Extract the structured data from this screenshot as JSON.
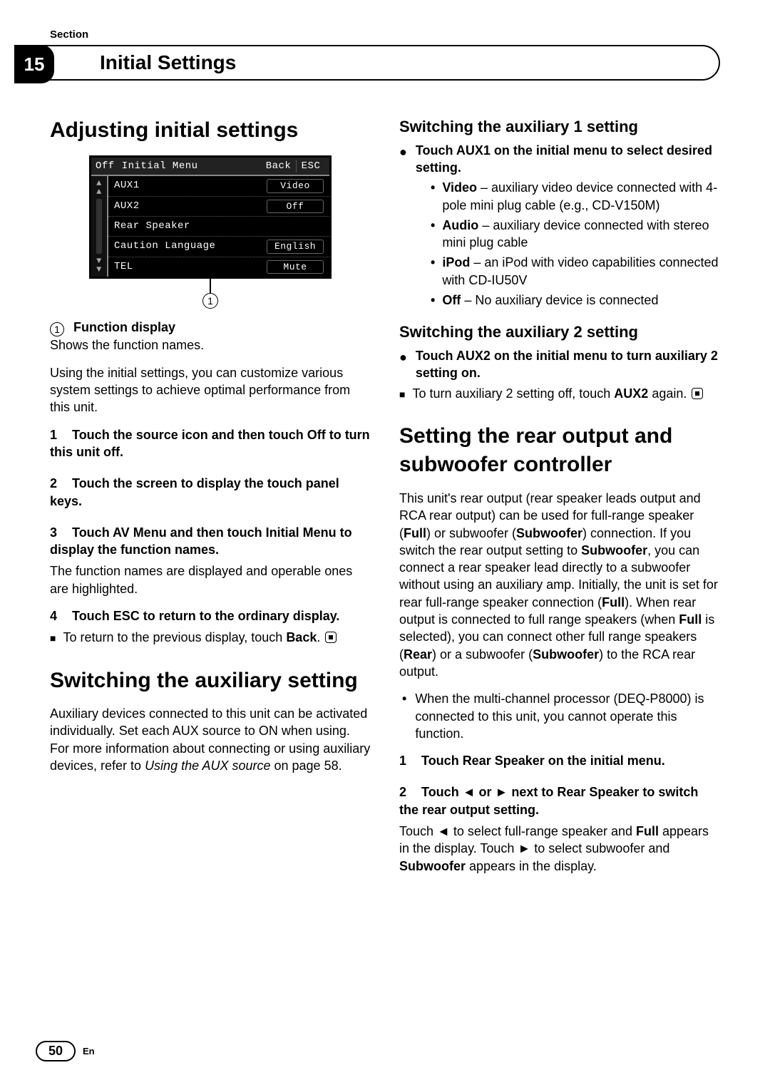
{
  "header": {
    "section_label": "Section",
    "section_number": "15",
    "chapter_title": "Initial Settings"
  },
  "figure": {
    "top_off": "Off",
    "top_title": "Initial Menu",
    "top_back": "Back",
    "top_esc": "ESC",
    "rows": [
      {
        "label": "AUX1",
        "value": "Video"
      },
      {
        "label": "AUX2",
        "value": "Off"
      },
      {
        "label": "Rear Speaker",
        "value": ""
      },
      {
        "label": "Caution Language",
        "value": "English"
      },
      {
        "label": "TEL",
        "value": "Mute"
      }
    ],
    "callout": "1"
  },
  "left": {
    "h1": "Adjusting initial settings",
    "callout_title": "Function display",
    "callout_desc": "Shows the function names.",
    "intro": "Using the initial settings, you can customize various system settings to achieve optimal performance from this unit.",
    "steps": {
      "s1": {
        "n": "1",
        "t": "Touch the source icon and then touch Off to turn this unit off."
      },
      "s2": {
        "n": "2",
        "t": "Touch the screen to display the touch panel keys."
      },
      "s3": {
        "n": "3",
        "t": "Touch AV Menu and then touch Initial Menu to display the function names.",
        "c": "The function names are displayed and operable ones are highlighted."
      },
      "s4": {
        "n": "4",
        "t": "Touch ESC to return to the ordinary display."
      }
    },
    "note_prev_a": "To return to the previous display, touch ",
    "note_prev_b": "Back",
    "note_prev_c": ".",
    "h2": "Switching the auxiliary setting",
    "aux_para_a": "Auxiliary devices connected to this unit can be activated individually. Set each AUX source to ON when using. For more information about connecting or using auxiliary devices, refer to ",
    "aux_para_i": "Using the AUX source",
    "aux_para_b": " on page 58."
  },
  "right": {
    "aux1_h": "Switching the auxiliary 1 setting",
    "aux1_lead": "Touch AUX1 on the initial menu to select desired setting.",
    "aux1_opts": {
      "video": {
        "b": "Video",
        "t": " – auxiliary video device connected with 4-pole mini plug cable (e.g., CD-V150M)"
      },
      "audio": {
        "b": "Audio",
        "t": " – auxiliary device connected with stereo mini plug cable"
      },
      "ipod": {
        "b": "iPod",
        "t": " – an iPod with video capabilities connected with CD-IU50V"
      },
      "off": {
        "b": "Off",
        "t": " – No auxiliary device is connected"
      }
    },
    "aux2_h": "Switching the auxiliary 2 setting",
    "aux2_lead": "Touch AUX2 on the initial menu to turn auxiliary 2 setting on.",
    "aux2_note_a": "To turn auxiliary 2 setting off, touch ",
    "aux2_note_b": "AUX2",
    "aux2_note_c": " again.",
    "rear_h1": "Setting the rear output and subwoofer controller",
    "rear_p_a": "This unit's rear output (rear speaker leads output and RCA rear output) can be used for full-range speaker (",
    "rear_p_b": "Full",
    "rear_p_c": ") or subwoofer (",
    "rear_p_d": "Subwoofer",
    "rear_p_e": ") connection. If you switch the rear output setting to ",
    "rear_p_f": "Subwoofer",
    "rear_p_g": ", you can connect a rear speaker lead directly to a subwoofer without using an auxiliary amp. Initially, the unit is set for rear full-range speaker connection (",
    "rear_p_h": "Full",
    "rear_p_i": "). When rear output is connected to full range speakers (when ",
    "rear_p_j": "Full",
    "rear_p_k": " is selected), you can connect other full range speakers (",
    "rear_p_l": "Rear",
    "rear_p_m": ") or a subwoofer (",
    "rear_p_n": "Subwoofer",
    "rear_p_o": ") to the RCA rear output.",
    "rear_bullet": "When the multi-channel processor (DEQ-P8000) is connected to this unit, you cannot operate this function.",
    "rear_s1": {
      "n": "1",
      "t": "Touch Rear Speaker on the initial menu."
    },
    "rear_s2": {
      "n": "2",
      "t": "Touch ◄ or ► next to Rear Speaker to switch the rear output setting."
    },
    "rear_s2c_a": "Touch ◄ to select full-range speaker and ",
    "rear_s2c_b": "Full",
    "rear_s2c_c": " appears in the display. Touch ► to select subwoofer and ",
    "rear_s2c_d": "Subwoofer",
    "rear_s2c_e": " appears in the display."
  },
  "footer": {
    "page": "50",
    "lang": "En"
  }
}
